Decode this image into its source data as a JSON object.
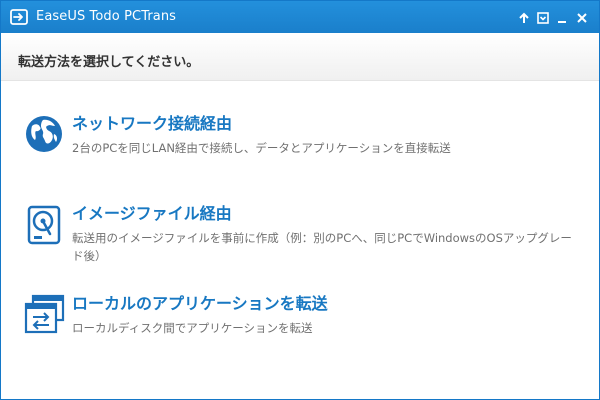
{
  "window": {
    "title": "EaseUS Todo PCTrans",
    "controls": [
      {
        "name": "up-arrow-button",
        "icon": "up-arrow-icon"
      },
      {
        "name": "menu-button",
        "icon": "menu-box-icon"
      },
      {
        "name": "minimize-button",
        "icon": "minimize-icon"
      },
      {
        "name": "close-button",
        "icon": "close-icon"
      }
    ]
  },
  "header": {
    "prompt": "転送方法を選択してください。"
  },
  "options": [
    {
      "icon": "globe-icon",
      "title": "ネットワーク接続経由",
      "description": "2台のPCを同じLAN経由で接続し、データとアプリケーションを直接転送"
    },
    {
      "icon": "hard-drive-icon",
      "title": "イメージファイル経由",
      "description": "転送用のイメージファイルを事前に作成（例：別のPCへ、同じPCでWindowsのOSアップグレード後）"
    },
    {
      "icon": "window-transfer-icon",
      "title": "ローカルのアプリケーションを転送",
      "description": "ローカルディスク間でアプリケーションを転送"
    }
  ],
  "colors": {
    "titlebar": "#1a7fcb",
    "accent": "#1878c2",
    "description": "#707070"
  }
}
